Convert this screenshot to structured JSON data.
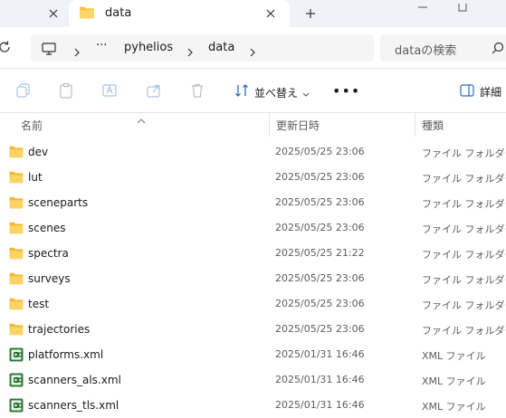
{
  "tabs": {
    "active_title": "data",
    "new_tab": "+"
  },
  "address": {
    "more": "···",
    "crumbs": [
      "pyhelios",
      "data"
    ],
    "search_placeholder": "dataの検索"
  },
  "commands": {
    "sort_label": "並べ替え",
    "more": "•••",
    "details_label": "詳細"
  },
  "columns": {
    "name": "名前",
    "date": "更新日時",
    "type": "種類"
  },
  "files": [
    {
      "name": "dev",
      "date": "2025/05/25 23:06",
      "type": "ファイル フォルダー",
      "icon": "folder-icon"
    },
    {
      "name": "lut",
      "date": "2025/05/25 23:06",
      "type": "ファイル フォルダー",
      "icon": "folder-icon"
    },
    {
      "name": "sceneparts",
      "date": "2025/05/25 23:06",
      "type": "ファイル フォルダー",
      "icon": "folder-icon"
    },
    {
      "name": "scenes",
      "date": "2025/05/25 23:06",
      "type": "ファイル フォルダー",
      "icon": "folder-icon"
    },
    {
      "name": "spectra",
      "date": "2025/05/25 21:22",
      "type": "ファイル フォルダー",
      "icon": "folder-icon"
    },
    {
      "name": "surveys",
      "date": "2025/05/25 23:06",
      "type": "ファイル フォルダー",
      "icon": "folder-icon"
    },
    {
      "name": "test",
      "date": "2025/05/25 23:06",
      "type": "ファイル フォルダー",
      "icon": "folder-icon"
    },
    {
      "name": "trajectories",
      "date": "2025/05/25 23:06",
      "type": "ファイル フォルダー",
      "icon": "folder-icon"
    },
    {
      "name": "platforms.xml",
      "date": "2025/01/31 16:46",
      "type": "XML ファイル",
      "icon": "xml-file-icon"
    },
    {
      "name": "scanners_als.xml",
      "date": "2025/01/31 16:46",
      "type": "XML ファイル",
      "icon": "xml-file-icon"
    },
    {
      "name": "scanners_tls.xml",
      "date": "2025/01/31 16:46",
      "type": "XML ファイル",
      "icon": "xml-file-icon"
    }
  ],
  "colors": {
    "folder": "#f8c542",
    "xml_icon": "#3a9a3a",
    "tabstrip_bg": "#eef3f9"
  }
}
